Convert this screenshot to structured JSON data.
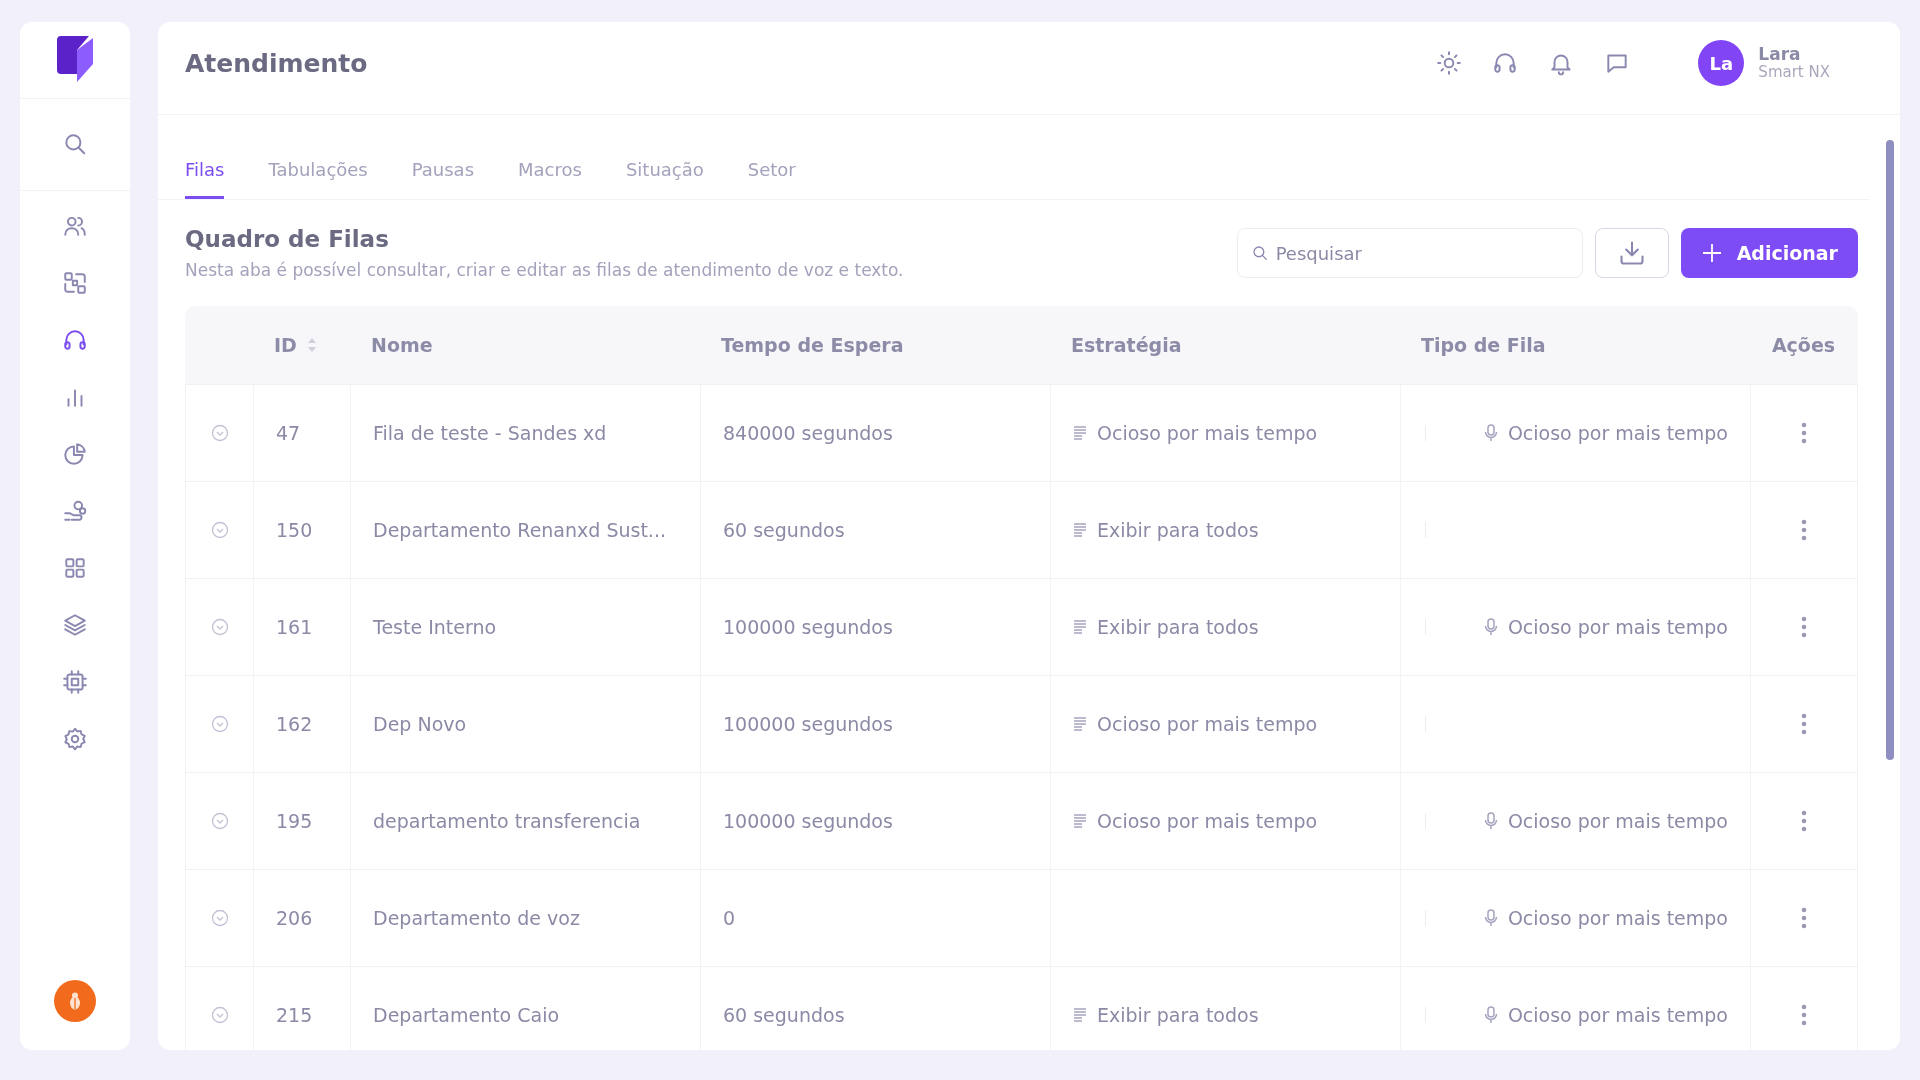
{
  "sidebar": {
    "items": [
      {
        "selected": false
      },
      {
        "selected": false
      },
      {
        "selected": false
      },
      {
        "selected": true
      },
      {
        "selected": false
      },
      {
        "selected": false
      },
      {
        "selected": false
      },
      {
        "selected": false
      },
      {
        "selected": false
      },
      {
        "selected": false
      },
      {
        "selected": false
      }
    ]
  },
  "header": {
    "title": "Atendimento",
    "user": {
      "initials": "La",
      "name": "Lara",
      "company": "Smart NX"
    }
  },
  "tabs": [
    {
      "label": "Filas",
      "selected": true
    },
    {
      "label": "Tabulações",
      "selected": false
    },
    {
      "label": "Pausas",
      "selected": false
    },
    {
      "label": "Macros",
      "selected": false
    },
    {
      "label": "Situação",
      "selected": false
    },
    {
      "label": "Setor",
      "selected": false
    }
  ],
  "section": {
    "title": "Quadro de Filas",
    "description": "Nesta aba é possível consultar, criar e editar as filas de atendimento de voz e texto.",
    "search": {
      "placeholder": "Pesquisar"
    },
    "add_button": "Adicionar"
  },
  "table": {
    "columns": [
      "ID",
      "Nome",
      "Tempo de Espera",
      "Estratégia",
      "Tipo de Fila",
      "Ações"
    ],
    "rows": [
      {
        "id": "47",
        "name": "Fila de teste - Sandes xd",
        "wait": "840000 segundos",
        "strategy": "Ocioso por mais tempo",
        "queue_type": "Ocioso por mais tempo"
      },
      {
        "id": "150",
        "name": "Departamento Renanxd Sust...",
        "wait": "60 segundos",
        "strategy": "Exibir para todos"
      },
      {
        "id": "161",
        "name": "Teste Interno",
        "wait": "100000 segundos",
        "strategy": "Exibir para todos",
        "queue_type": "Ocioso por mais tempo"
      },
      {
        "id": "162",
        "name": "Dep Novo",
        "wait": "100000 segundos",
        "strategy": "Ocioso por mais tempo"
      },
      {
        "id": "195",
        "name": "departamento transferencia",
        "wait": "100000 segundos",
        "strategy": "Ocioso por mais tempo",
        "queue_type": "Ocioso por mais tempo"
      },
      {
        "id": "206",
        "name": "Departamento de voz",
        "wait": "0",
        "queue_type": "Ocioso por mais tempo"
      },
      {
        "id": "215",
        "name": "Departamento Caio",
        "wait": "60 segundos",
        "strategy": "Exibir para todos",
        "queue_type": "Ocioso por mais tempo"
      }
    ]
  }
}
